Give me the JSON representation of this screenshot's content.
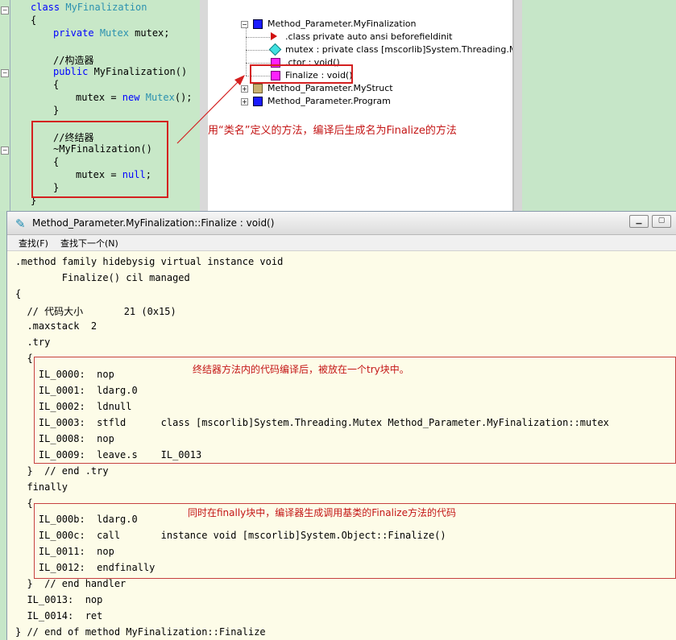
{
  "code_editor": {
    "lines": [
      {
        "class_kw": "class",
        "name": "MyFinalization"
      },
      "{",
      {
        "mod": "private",
        "type": "Mutex",
        "rest": " mutex;"
      },
      "//构造器",
      {
        "mod": "public",
        "rest": " MyFinalization()"
      },
      "{",
      {
        "pre": "mutex = ",
        "kw": "new",
        "type": "Mutex",
        "post": "();"
      },
      "}",
      "//终结器",
      "~MyFinalization()",
      "{",
      {
        "pre": "mutex = ",
        "kw": "null",
        "post": ";"
      },
      "}",
      "}"
    ]
  },
  "tree": {
    "items": [
      {
        "label": "Method_Parameter.MyFinalization",
        "icon": "class-icon"
      },
      {
        "label": ".class private auto ansi beforefieldinit",
        "icon": "metadata-icon"
      },
      {
        "label": "mutex : private class [mscorlib]System.Threading.Mutex",
        "icon": "field-icon"
      },
      {
        "label": ".ctor : void()",
        "icon": "method-icon"
      },
      {
        "label": "Finalize : void()",
        "icon": "method-icon"
      },
      {
        "label": "Method_Parameter.MyStruct",
        "icon": "struct-icon"
      },
      {
        "label": "Method_Parameter.Program",
        "icon": "class-icon"
      }
    ],
    "expand_minus": "−",
    "expand_plus": "+"
  },
  "annotations": {
    "top": "用“类名”定义的方法，编译后生成名为Finalize的方法",
    "try_block": "终结器方法内的代码编译后，被放在一个try块中。",
    "finally_block": "同时在finally块中，编译器生成调用基类的Finalize方法的代码"
  },
  "il_window": {
    "title": "Method_Parameter.MyFinalization::Finalize : void()",
    "title_icon": "pen-icon",
    "menu": [
      "查找(F)",
      "查找下一个(N)"
    ],
    "minimize": "▁",
    "maximize": "▢",
    "lines": [
      ".method family hidebysig virtual instance void",
      "        Finalize() cil managed",
      "{",
      "  // 代码大小       21 (0x15)",
      "  .maxstack  2",
      "  .try",
      "  {",
      "    IL_0000:  nop",
      "    IL_0001:  ldarg.0",
      "    IL_0002:  ldnull",
      "    IL_0003:  stfld      class [mscorlib]System.Threading.Mutex Method_Parameter.MyFinalization::mutex",
      "    IL_0008:  nop",
      "    IL_0009:  leave.s    IL_0013",
      "  }  // end .try",
      "  finally",
      "  {",
      "    IL_000b:  ldarg.0",
      "    IL_000c:  call       instance void [mscorlib]System.Object::Finalize()",
      "    IL_0011:  nop",
      "    IL_0012:  endfinally",
      "  }  // end handler",
      "  IL_0013:  nop",
      "  IL_0014:  ret",
      "} // end of method MyFinalization::Finalize"
    ]
  }
}
